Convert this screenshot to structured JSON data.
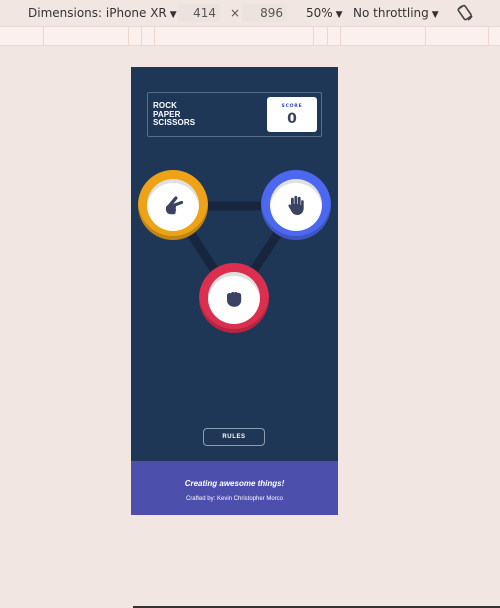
{
  "devtools": {
    "device_label": "Dimensions: iPhone XR",
    "width": "414",
    "times": "×",
    "height": "896",
    "zoom": "50%",
    "throttling": "No throttling",
    "icons": {
      "dropdown": "caret-down-icon",
      "rotate": "rotate-icon"
    }
  },
  "game": {
    "title_lines": [
      "ROCK",
      "PAPER",
      "SCISSORS"
    ],
    "score_label": "SCORE",
    "score_value": "0",
    "choices": [
      {
        "name": "scissors",
        "icon": "hand-scissors-icon",
        "color": "#eda217"
      },
      {
        "name": "paper",
        "icon": "hand-paper-icon",
        "color": "#4d68f0"
      },
      {
        "name": "rock",
        "icon": "hand-rock-icon",
        "color": "#dc2e4e"
      }
    ],
    "rules_label": "RULES"
  },
  "footer": {
    "tagline": "Creating awesome things!",
    "credit": "Crafted by: Kevin Christopher Morco"
  },
  "colors": {
    "page_bg": "#f1e6e2",
    "screen_bg": "#1f3756",
    "footer_bg": "#4d4fac",
    "icon_fill": "#3b4363"
  }
}
